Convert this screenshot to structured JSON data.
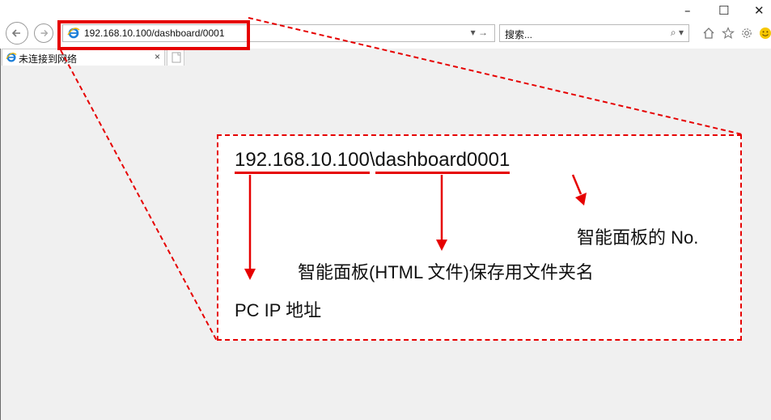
{
  "window": {
    "minimize_glyph": "–",
    "maximize_glyph": "☐",
    "close_glyph": "✕"
  },
  "browser": {
    "address_url": "192.168.10.100/dashboard/0001",
    "address_actions": "▾ →",
    "search_placeholder": "搜索...",
    "search_actions": "⌕ ▾",
    "tabs": [
      {
        "label": "未连接到网络",
        "close": "×"
      }
    ],
    "icons": [
      "home-icon",
      "star-icon",
      "gear-icon",
      "smiley-icon",
      "back-icon",
      "forward-icon",
      "ie-icon"
    ]
  },
  "annotation": {
    "url_ip": "192.168.10.100",
    "url_sep": "\\",
    "url_folder": "dashboard0001",
    "label_no": "智能面板的 No.",
    "label_folder": "智能面板(HTML 文件)保存用文件夹名",
    "label_ip": "PC IP 地址",
    "color": "#e60000"
  }
}
